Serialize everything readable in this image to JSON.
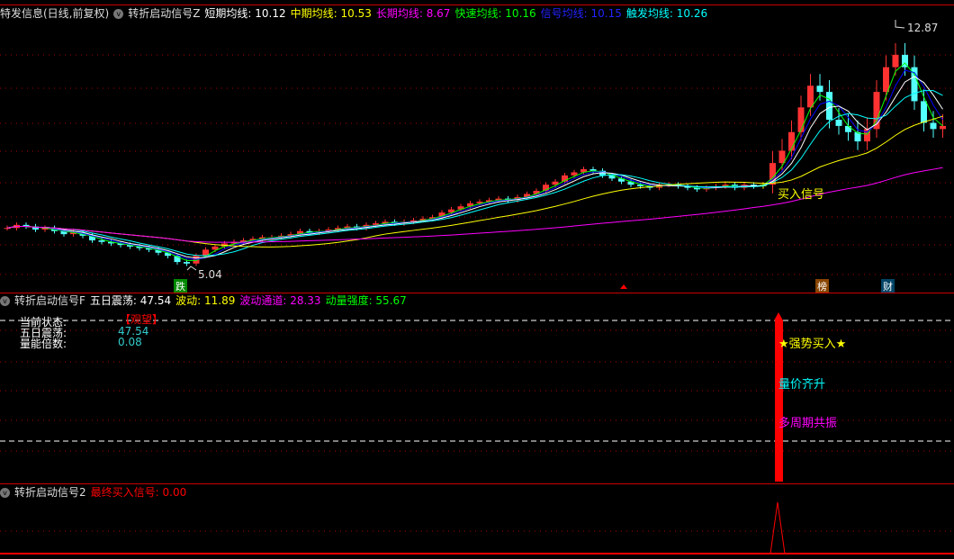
{
  "main": {
    "title": "特发信息(日线,前复权)",
    "indicator": "转折启动信号Z",
    "ma_short_label": "短期均线: 10.12",
    "ma_mid_label": "中期均线: 10.53",
    "ma_long_label": "长期均线: 8.67",
    "ma_fast_label": "快速均线: 10.16",
    "ma_signal_label": "信号均线: 10.15",
    "ma_trigger_label": "触发均线: 10.26",
    "high_label": "12.87",
    "low_label": "5.04",
    "buy_label": "买入信号",
    "tags": [
      "跌",
      "榜",
      "财"
    ]
  },
  "panel2": {
    "indicator": "转折启动信号F",
    "v1": "五日震荡: 47.54",
    "v2": "波动: 11.89",
    "v3": "波动通道: 28.33",
    "v4": "动量强度: 55.67",
    "status_label": "当前状态:",
    "status_value": "【观望】",
    "osc_label": "五日震荡:",
    "osc_value": "47.54",
    "vol_label": "量能倍数:",
    "vol_value": "0.08",
    "sig1": "★强势买入★",
    "sig2": "量价齐升",
    "sig3": "多周期共振"
  },
  "panel3": {
    "indicator": "转折启动信号2",
    "v1": "最终买入信号: 0.00"
  },
  "colors": {
    "up": "#ff3232",
    "down": "#54ffff",
    "ma5": "#ffffff",
    "ma10": "#ffff00",
    "ma20": "#ff00ff",
    "fast": "#00ff00",
    "signal": "#0000ff",
    "trigger": "#00ffff"
  },
  "chart_data": {
    "type": "candlestick",
    "price_range": [
      5.04,
      12.87
    ],
    "closes": [
      6.4,
      6.5,
      6.45,
      6.35,
      6.4,
      6.3,
      6.2,
      6.25,
      6.15,
      6.0,
      5.95,
      5.9,
      5.85,
      5.8,
      5.75,
      5.7,
      5.6,
      5.5,
      5.3,
      5.25,
      5.5,
      5.7,
      5.8,
      5.9,
      5.95,
      6.0,
      6.05,
      6.1,
      6.1,
      6.15,
      6.2,
      6.3,
      6.25,
      6.3,
      6.35,
      6.4,
      6.45,
      6.4,
      6.5,
      6.55,
      6.6,
      6.55,
      6.6,
      6.65,
      6.7,
      6.75,
      6.9,
      7.0,
      7.1,
      7.2,
      7.25,
      7.3,
      7.35,
      7.3,
      7.4,
      7.5,
      7.6,
      7.8,
      7.9,
      8.1,
      8.2,
      8.3,
      8.25,
      8.1,
      8.0,
      7.9,
      7.8,
      7.75,
      7.7,
      7.8,
      7.8,
      7.75,
      7.7,
      7.65,
      7.7,
      7.75,
      7.8,
      7.7,
      7.8,
      7.75,
      7.8,
      8.5,
      8.9,
      9.5,
      10.3,
      11.0,
      10.8,
      9.9,
      9.7,
      9.5,
      9.2,
      9.6,
      10.8,
      11.6,
      12.0,
      11.6,
      10.5,
      9.8,
      9.6,
      9.7
    ],
    "signal_index": 80
  }
}
